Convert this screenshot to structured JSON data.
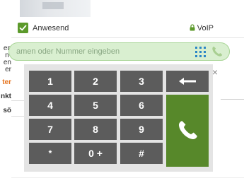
{
  "status": {
    "label": "Anwesend",
    "checked": true,
    "connection": "VoIP"
  },
  "search": {
    "placeholder": "amen oder Nummer eingeben"
  },
  "left_panel": {
    "lines": [
      "en",
      "n-",
      "en",
      "er"
    ],
    "orange_text": "ter",
    "dark_text_1": "nkt",
    "dark_text_2": "sö"
  },
  "dialpad": {
    "keys": [
      "1",
      "2",
      "3",
      "4",
      "5",
      "6",
      "7",
      "8",
      "9",
      "*",
      "0 +",
      "#"
    ],
    "backspace_icon": "arrow-left-icon",
    "call_icon": "phone-icon",
    "close_symbol": "×"
  },
  "colors": {
    "accent_green": "#57882a",
    "search_bg": "#d9efd0",
    "key_bg": "#5c5c5c",
    "grid_blue": "#2b86c6"
  }
}
